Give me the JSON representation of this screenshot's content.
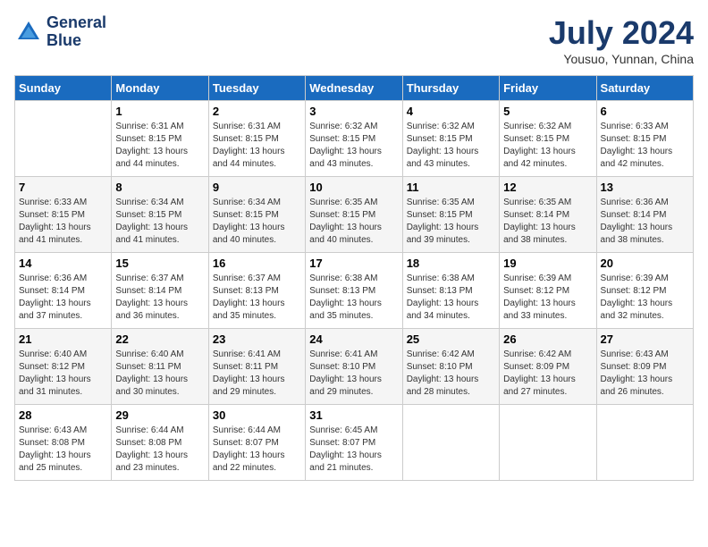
{
  "header": {
    "logo_line1": "General",
    "logo_line2": "Blue",
    "month_year": "July 2024",
    "location": "Yousuo, Yunnan, China"
  },
  "days_of_week": [
    "Sunday",
    "Monday",
    "Tuesday",
    "Wednesday",
    "Thursday",
    "Friday",
    "Saturday"
  ],
  "weeks": [
    [
      {
        "day": "",
        "sunrise": "",
        "sunset": "",
        "daylight": ""
      },
      {
        "day": "1",
        "sunrise": "Sunrise: 6:31 AM",
        "sunset": "Sunset: 8:15 PM",
        "daylight": "Daylight: 13 hours and 44 minutes."
      },
      {
        "day": "2",
        "sunrise": "Sunrise: 6:31 AM",
        "sunset": "Sunset: 8:15 PM",
        "daylight": "Daylight: 13 hours and 44 minutes."
      },
      {
        "day": "3",
        "sunrise": "Sunrise: 6:32 AM",
        "sunset": "Sunset: 8:15 PM",
        "daylight": "Daylight: 13 hours and 43 minutes."
      },
      {
        "day": "4",
        "sunrise": "Sunrise: 6:32 AM",
        "sunset": "Sunset: 8:15 PM",
        "daylight": "Daylight: 13 hours and 43 minutes."
      },
      {
        "day": "5",
        "sunrise": "Sunrise: 6:32 AM",
        "sunset": "Sunset: 8:15 PM",
        "daylight": "Daylight: 13 hours and 42 minutes."
      },
      {
        "day": "6",
        "sunrise": "Sunrise: 6:33 AM",
        "sunset": "Sunset: 8:15 PM",
        "daylight": "Daylight: 13 hours and 42 minutes."
      }
    ],
    [
      {
        "day": "7",
        "sunrise": "Sunrise: 6:33 AM",
        "sunset": "Sunset: 8:15 PM",
        "daylight": "Daylight: 13 hours and 41 minutes."
      },
      {
        "day": "8",
        "sunrise": "Sunrise: 6:34 AM",
        "sunset": "Sunset: 8:15 PM",
        "daylight": "Daylight: 13 hours and 41 minutes."
      },
      {
        "day": "9",
        "sunrise": "Sunrise: 6:34 AM",
        "sunset": "Sunset: 8:15 PM",
        "daylight": "Daylight: 13 hours and 40 minutes."
      },
      {
        "day": "10",
        "sunrise": "Sunrise: 6:35 AM",
        "sunset": "Sunset: 8:15 PM",
        "daylight": "Daylight: 13 hours and 40 minutes."
      },
      {
        "day": "11",
        "sunrise": "Sunrise: 6:35 AM",
        "sunset": "Sunset: 8:15 PM",
        "daylight": "Daylight: 13 hours and 39 minutes."
      },
      {
        "day": "12",
        "sunrise": "Sunrise: 6:35 AM",
        "sunset": "Sunset: 8:14 PM",
        "daylight": "Daylight: 13 hours and 38 minutes."
      },
      {
        "day": "13",
        "sunrise": "Sunrise: 6:36 AM",
        "sunset": "Sunset: 8:14 PM",
        "daylight": "Daylight: 13 hours and 38 minutes."
      }
    ],
    [
      {
        "day": "14",
        "sunrise": "Sunrise: 6:36 AM",
        "sunset": "Sunset: 8:14 PM",
        "daylight": "Daylight: 13 hours and 37 minutes."
      },
      {
        "day": "15",
        "sunrise": "Sunrise: 6:37 AM",
        "sunset": "Sunset: 8:14 PM",
        "daylight": "Daylight: 13 hours and 36 minutes."
      },
      {
        "day": "16",
        "sunrise": "Sunrise: 6:37 AM",
        "sunset": "Sunset: 8:13 PM",
        "daylight": "Daylight: 13 hours and 35 minutes."
      },
      {
        "day": "17",
        "sunrise": "Sunrise: 6:38 AM",
        "sunset": "Sunset: 8:13 PM",
        "daylight": "Daylight: 13 hours and 35 minutes."
      },
      {
        "day": "18",
        "sunrise": "Sunrise: 6:38 AM",
        "sunset": "Sunset: 8:13 PM",
        "daylight": "Daylight: 13 hours and 34 minutes."
      },
      {
        "day": "19",
        "sunrise": "Sunrise: 6:39 AM",
        "sunset": "Sunset: 8:12 PM",
        "daylight": "Daylight: 13 hours and 33 minutes."
      },
      {
        "day": "20",
        "sunrise": "Sunrise: 6:39 AM",
        "sunset": "Sunset: 8:12 PM",
        "daylight": "Daylight: 13 hours and 32 minutes."
      }
    ],
    [
      {
        "day": "21",
        "sunrise": "Sunrise: 6:40 AM",
        "sunset": "Sunset: 8:12 PM",
        "daylight": "Daylight: 13 hours and 31 minutes."
      },
      {
        "day": "22",
        "sunrise": "Sunrise: 6:40 AM",
        "sunset": "Sunset: 8:11 PM",
        "daylight": "Daylight: 13 hours and 30 minutes."
      },
      {
        "day": "23",
        "sunrise": "Sunrise: 6:41 AM",
        "sunset": "Sunset: 8:11 PM",
        "daylight": "Daylight: 13 hours and 29 minutes."
      },
      {
        "day": "24",
        "sunrise": "Sunrise: 6:41 AM",
        "sunset": "Sunset: 8:10 PM",
        "daylight": "Daylight: 13 hours and 29 minutes."
      },
      {
        "day": "25",
        "sunrise": "Sunrise: 6:42 AM",
        "sunset": "Sunset: 8:10 PM",
        "daylight": "Daylight: 13 hours and 28 minutes."
      },
      {
        "day": "26",
        "sunrise": "Sunrise: 6:42 AM",
        "sunset": "Sunset: 8:09 PM",
        "daylight": "Daylight: 13 hours and 27 minutes."
      },
      {
        "day": "27",
        "sunrise": "Sunrise: 6:43 AM",
        "sunset": "Sunset: 8:09 PM",
        "daylight": "Daylight: 13 hours and 26 minutes."
      }
    ],
    [
      {
        "day": "28",
        "sunrise": "Sunrise: 6:43 AM",
        "sunset": "Sunset: 8:08 PM",
        "daylight": "Daylight: 13 hours and 25 minutes."
      },
      {
        "day": "29",
        "sunrise": "Sunrise: 6:44 AM",
        "sunset": "Sunset: 8:08 PM",
        "daylight": "Daylight: 13 hours and 23 minutes."
      },
      {
        "day": "30",
        "sunrise": "Sunrise: 6:44 AM",
        "sunset": "Sunset: 8:07 PM",
        "daylight": "Daylight: 13 hours and 22 minutes."
      },
      {
        "day": "31",
        "sunrise": "Sunrise: 6:45 AM",
        "sunset": "Sunset: 8:07 PM",
        "daylight": "Daylight: 13 hours and 21 minutes."
      },
      {
        "day": "",
        "sunrise": "",
        "sunset": "",
        "daylight": ""
      },
      {
        "day": "",
        "sunrise": "",
        "sunset": "",
        "daylight": ""
      },
      {
        "day": "",
        "sunrise": "",
        "sunset": "",
        "daylight": ""
      }
    ]
  ]
}
